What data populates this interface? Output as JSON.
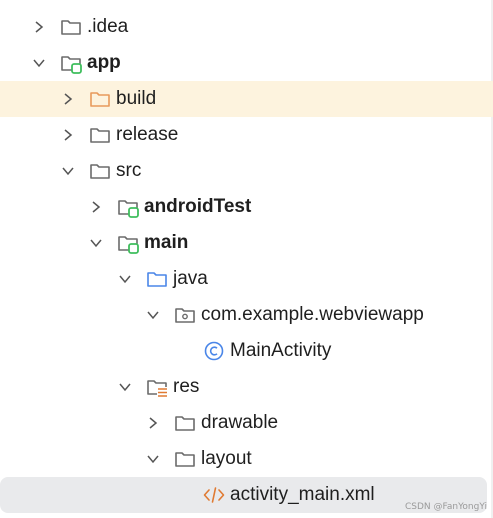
{
  "tree": {
    "items": [
      {
        "label": ".idea"
      },
      {
        "label": "app"
      },
      {
        "label": "build"
      },
      {
        "label": "release"
      },
      {
        "label": "src"
      },
      {
        "label": "androidTest"
      },
      {
        "label": "main"
      },
      {
        "label": "java"
      },
      {
        "label": "com.example.webviewapp"
      },
      {
        "label": "MainActivity"
      },
      {
        "label": "res"
      },
      {
        "label": "drawable"
      },
      {
        "label": "layout"
      },
      {
        "label": "activity_main.xml"
      }
    ]
  },
  "watermark": "CSDN @FanYongYi",
  "colors": {
    "highlight_row": "#fdf3de",
    "selected_row": "#e9eaec",
    "folder": "#6b6b6b",
    "excluded_folder": "#e89a5b",
    "source_folder": "#4a86e8",
    "module_badge": "#3fbe5d",
    "class_icon": "#4a86e8",
    "xml_icon": "#e07a32"
  }
}
